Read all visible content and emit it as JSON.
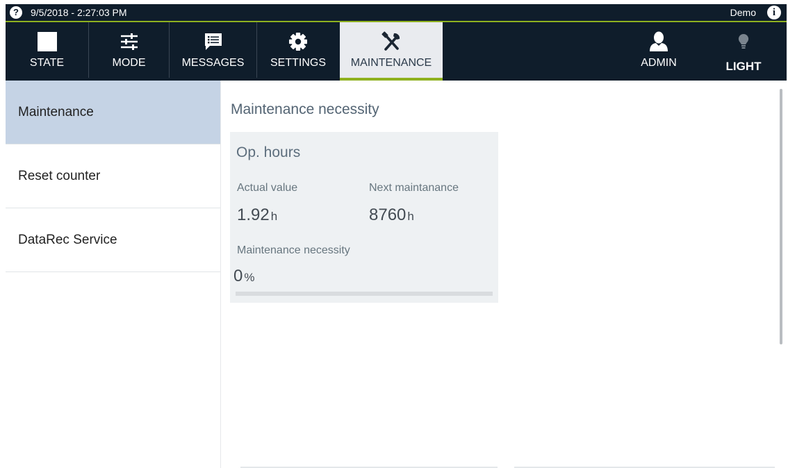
{
  "statusbar": {
    "datetime": "9/5/2018 - 2:27:03 PM",
    "user": "Demo"
  },
  "nav": {
    "items": [
      {
        "label": "STATE",
        "icon": "square-icon"
      },
      {
        "label": "MODE",
        "icon": "sliders-icon"
      },
      {
        "label": "MESSAGES",
        "icon": "message-list-icon"
      },
      {
        "label": "SETTINGS",
        "icon": "gear-icon"
      },
      {
        "label": "MAINTENANCE",
        "icon": "tools-icon",
        "active": true
      },
      {
        "label": "ADMIN",
        "icon": "user-icon"
      },
      {
        "label": "LIGHT",
        "icon": "lightbulb-icon"
      }
    ]
  },
  "sidebar": {
    "items": [
      {
        "label": "Maintenance",
        "active": true
      },
      {
        "label": "Reset counter"
      },
      {
        "label": "DataRec Service"
      }
    ]
  },
  "main": {
    "heading": "Maintenance necessity",
    "card": {
      "title": "Op. hours",
      "actual_label": "Actual value",
      "actual_value": "1.92",
      "actual_unit": "h",
      "next_label": "Next maintanance",
      "next_value": "8760",
      "next_unit": "h",
      "necessity_label": "Maintenance necessity",
      "necessity_value": "0",
      "necessity_unit": "%",
      "necessity_fraction": 0
    }
  },
  "colors": {
    "header_bg": "#0f1d2b",
    "accent": "#8fb11f",
    "sidebar_active": "#c5d3e5",
    "card_bg": "#eef1f3"
  }
}
